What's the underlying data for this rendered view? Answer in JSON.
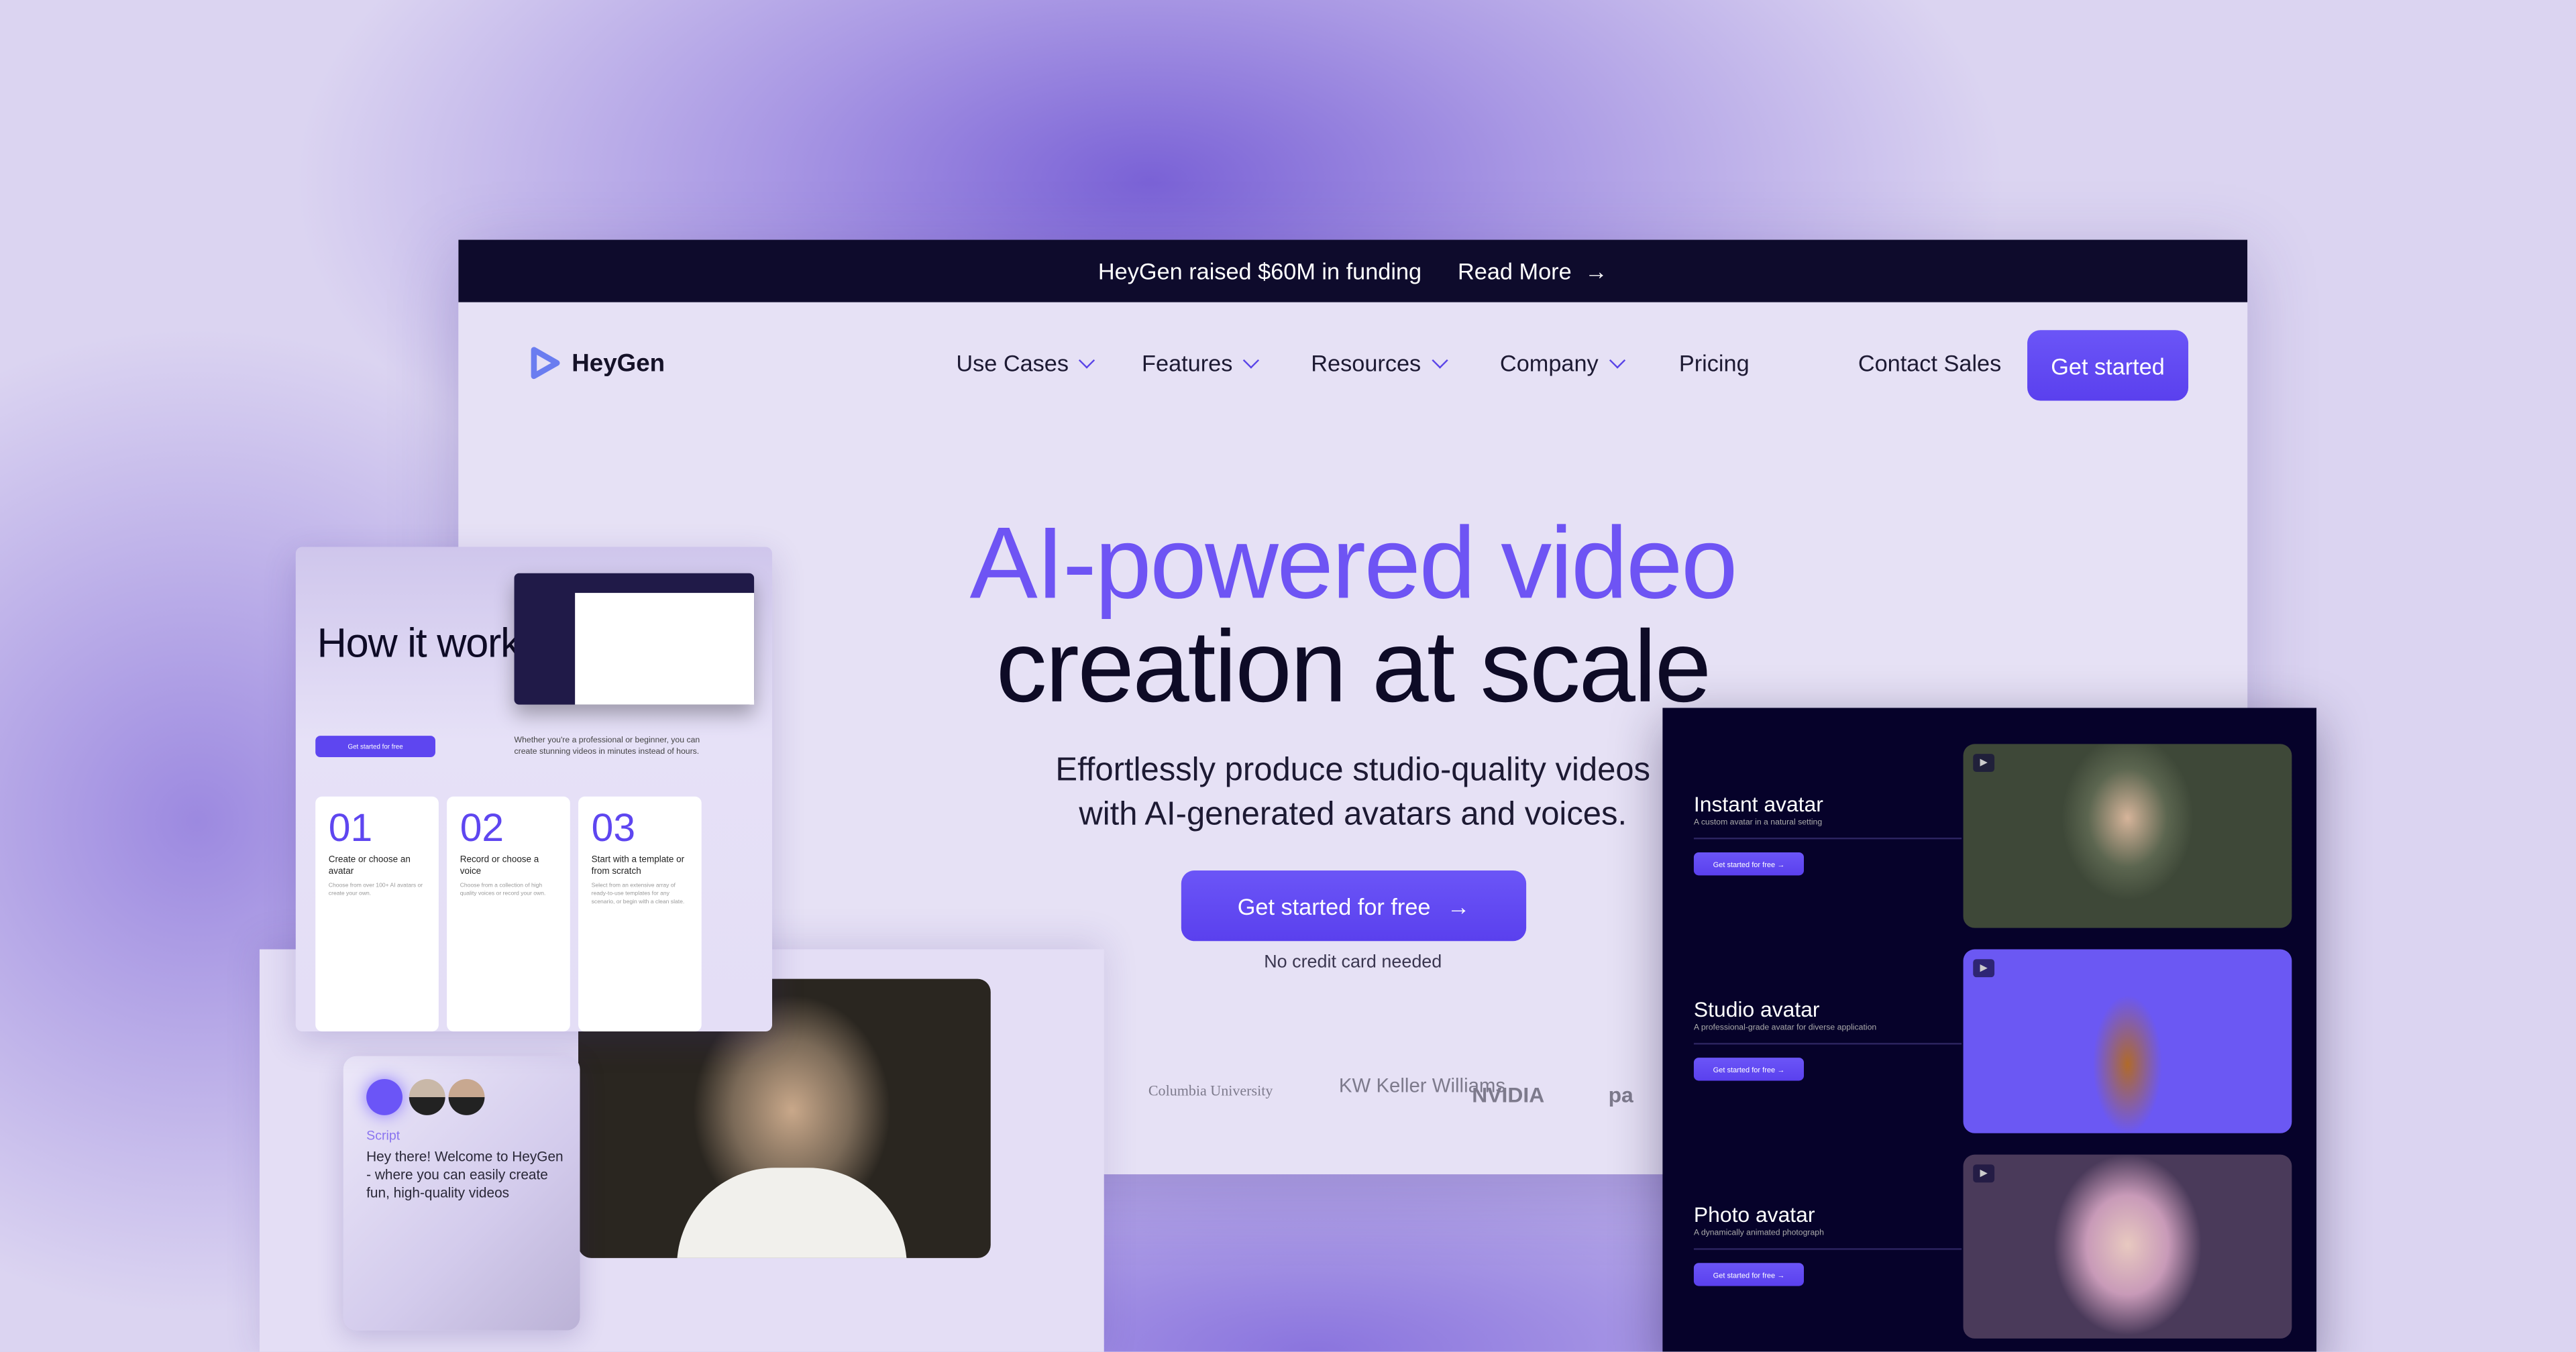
{
  "banner": {
    "text": "HeyGen raised $60M in funding",
    "link": "Read More"
  },
  "nav": {
    "brand": "HeyGen",
    "items": [
      {
        "label": "Use Cases",
        "dropdown": true
      },
      {
        "label": "Features",
        "dropdown": true
      },
      {
        "label": "Resources",
        "dropdown": true
      },
      {
        "label": "Company",
        "dropdown": true
      },
      {
        "label": "Pricing",
        "dropdown": false
      }
    ],
    "contact": "Contact Sales",
    "cta": "Get started"
  },
  "hero": {
    "title_line1": "AI-powered video",
    "title_line2": "creation at scale",
    "subtitle_line1": "Effortlessly produce studio-quality videos",
    "subtitle_line2": "with AI-generated avatars and voices.",
    "cta": "Get started for free",
    "note": "No credit card needed"
  },
  "logos": [
    "Columbia University",
    "KW Keller Williams",
    "NVIDIA",
    "pa"
  ],
  "how": {
    "title": "How it works",
    "button": "Get started for free",
    "desc": "Whether you're a professional or beginner, you can create stunning videos in minutes instead of hours.",
    "steps": [
      {
        "num": "01",
        "title": "Create or choose an avatar",
        "desc": "Choose from over 100+ AI avatars or create your own."
      },
      {
        "num": "02",
        "title": "Record or choose a voice",
        "desc": "Choose from a collection of high quality voices or record your own."
      },
      {
        "num": "03",
        "title": "Start with a template or from scratch",
        "desc": "Select from an extensive array of ready-to-use templates for any scenario, or begin with a clean slate."
      }
    ]
  },
  "script": {
    "label": "Script",
    "text": "Hey there! Welcome to HeyGen - where you can easily create fun, high-quality videos"
  },
  "avatars": [
    {
      "title": "Instant avatar",
      "desc": "A custom avatar in a natural setting",
      "button": "Get started for free →"
    },
    {
      "title": "Studio avatar",
      "desc": "A professional-grade avatar for diverse application",
      "button": "Get started for free →"
    },
    {
      "title": "Photo avatar",
      "desc": "A dynamically animated photograph",
      "button": "Get started for free →"
    }
  ],
  "colors": {
    "accent": "#6b55f7",
    "dark": "#0e0b2c",
    "panel": "#06022a"
  }
}
